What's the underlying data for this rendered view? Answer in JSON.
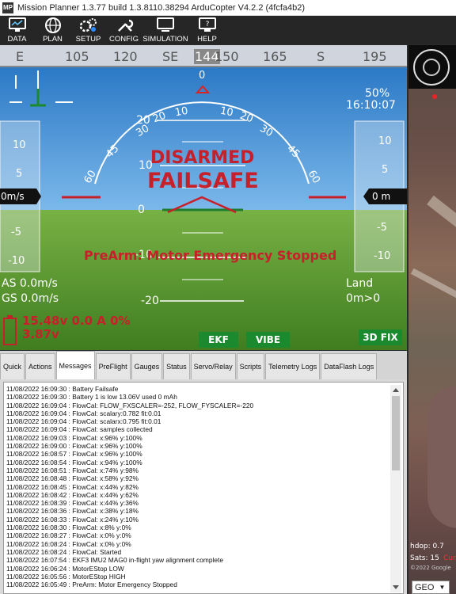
{
  "window": {
    "title": "Mission Planner 1.3.77 build 1.3.8110.38294 ArduCopter V4.2.2 (4fcfa4b2)",
    "icon_text": "MP"
  },
  "toolbar": {
    "items": [
      {
        "label": "DATA",
        "icon": "monitor-icon"
      },
      {
        "label": "PLAN",
        "icon": "globe-icon"
      },
      {
        "label": "SETUP",
        "icon": "gears-icon"
      },
      {
        "label": "CONFIG",
        "icon": "wrench-icon"
      },
      {
        "label": "SIMULATION",
        "icon": "computer-icon"
      },
      {
        "label": "HELP",
        "icon": "help-monitor-icon"
      }
    ]
  },
  "hud": {
    "heading_ticks": [
      "E",
      "105",
      "120",
      "SE",
      "144",
      "150",
      "165",
      "S",
      "195"
    ],
    "current_heading": "144",
    "battery_pct": "50%",
    "clock": "16:10:07",
    "status_primary": "DISARMED",
    "status_secondary": "FAILSAFE",
    "prearm_message": "PreArm: Motor Emergency Stopped",
    "airspeed": "AS 0.0m/s",
    "groundspeed": "GS 0.0m/s",
    "mode": "Land",
    "distance_home": "0m>0",
    "battery_line1": "15.48v 0.0 A 0%",
    "battery_line2": "3.87v",
    "left_tape_value": "0m/s",
    "right_tape_value": "0 m",
    "speed_tape_labels": [
      "10",
      "5",
      "-5",
      "-10"
    ],
    "alt_tape_labels": [
      "10",
      "5",
      "-5",
      "-10"
    ],
    "pitch_labels": [
      "20",
      "10",
      "0",
      "-10",
      "-20"
    ],
    "roll_labels": [
      "60",
      "45",
      "30",
      "20",
      "10",
      "0",
      "10",
      "20",
      "30",
      "45",
      "60"
    ],
    "badges": {
      "ekf": "EKF",
      "vibe": "VIBE",
      "gps": "3D FIX"
    },
    "colors": {
      "sky": "#3f8fd4",
      "ground": "#6aa53a",
      "alert": "#c8202a",
      "badge": "#1b8a2e"
    }
  },
  "tabs": [
    {
      "label": "Quick"
    },
    {
      "label": "Actions"
    },
    {
      "label": "Messages",
      "active": true
    },
    {
      "label": "PreFlight"
    },
    {
      "label": "Gauges"
    },
    {
      "label": "Status"
    },
    {
      "label": "Servo/Relay"
    },
    {
      "label": "Scripts"
    },
    {
      "label": "Telemetry Logs"
    },
    {
      "label": "DataFlash Logs"
    }
  ],
  "messages": [
    "11/08/2022 16:09:30 : Battery Failsafe",
    "11/08/2022 16:09:30 : Battery 1 is low 13.06V used 0 mAh",
    "11/08/2022 16:09:04 : FlowCal: FLOW_FXSCALER=-252, FLOW_FYSCALER=-220",
    "11/08/2022 16:09:04 : FlowCal: scalary:0.782 fit:0.01",
    "11/08/2022 16:09:04 : FlowCal: scalarx:0.795 fit:0.01",
    "11/08/2022 16:09:04 : FlowCal: samples collected",
    "11/08/2022 16:09:03 : FlowCal: x:96% y:100%",
    "11/08/2022 16:09:00 : FlowCal: x:96% y:100%",
    "11/08/2022 16:08:57 : FlowCal: x:96% y:100%",
    "11/08/2022 16:08:54 : FlowCal: x:94% y:100%",
    "11/08/2022 16:08:51 : FlowCal: x:74% y:98%",
    "11/08/2022 16:08:48 : FlowCal: x:58% y:92%",
    "11/08/2022 16:08:45 : FlowCal: x:44% y:82%",
    "11/08/2022 16:08:42 : FlowCal: x:44% y:62%",
    "11/08/2022 16:08:39 : FlowCal: x:44% y:36%",
    "11/08/2022 16:08:36 : FlowCal: x:38% y:18%",
    "11/08/2022 16:08:33 : FlowCal: x:24% y:10%",
    "11/08/2022 16:08:30 : FlowCal: x:8% y:0%",
    "11/08/2022 16:08:27 : FlowCal: x:0% y:0%",
    "11/08/2022 16:08:24 : FlowCal: x:0% y:0%",
    "11/08/2022 16:08:24 : FlowCal: Started",
    "11/08/2022 16:07:54 : EKF3 IMU2 MAG0 in-flight yaw alignment complete",
    "11/08/2022 16:06:24 : MotorEStop LOW",
    "11/08/2022 16:05:56 : MotorEStop HIGH",
    "11/08/2022 16:05:49 : PreArm: Motor Emergency Stopped"
  ],
  "map": {
    "hdop": "hdop: 0.7",
    "sats": "Sats: 15",
    "current_label": "Curr",
    "copyright": "©2022 Google",
    "geo_select": "GEO"
  }
}
